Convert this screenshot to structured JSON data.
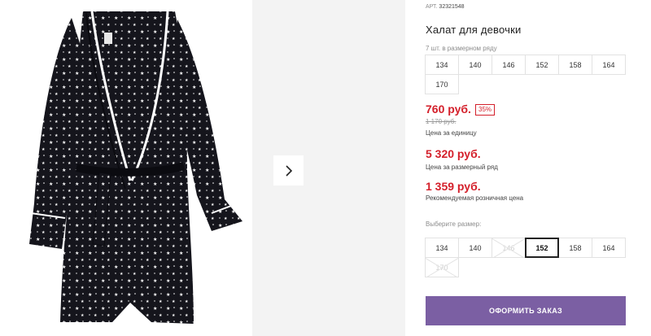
{
  "product": {
    "sku_label": "АРТ.",
    "sku_value": "32321548",
    "title": "Халат для девочки",
    "pack_note": "7 шт. в размерном ряду"
  },
  "pack_sizes": [
    "134",
    "140",
    "146",
    "152",
    "158",
    "164",
    "170"
  ],
  "prices": {
    "current": "760 руб.",
    "discount": "35%",
    "old": "1 170 руб.",
    "unit_label": "Цена за единицу",
    "pack": "5 320 руб.",
    "pack_label": "Цена за размерный ряд",
    "rrp": "1 359 руб.",
    "rrp_label": "Рекомендуемая розничная цена"
  },
  "size_selector": {
    "label": "Выберите размер:",
    "options": [
      {
        "label": "134",
        "state": "available"
      },
      {
        "label": "140",
        "state": "available"
      },
      {
        "label": "146",
        "state": "disabled"
      },
      {
        "label": "152",
        "state": "selected"
      },
      {
        "label": "158",
        "state": "available"
      },
      {
        "label": "164",
        "state": "available"
      },
      {
        "label": "170",
        "state": "disabled"
      }
    ]
  },
  "actions": {
    "order_label": "ОФОРМИТЬ ЗАКАЗ"
  },
  "colors": {
    "price_red": "#d4202b",
    "order_button": "#7b5fa3",
    "robe_fabric": "#15151c",
    "piping": "#ffffff"
  },
  "icons": {
    "gallery_next": "chevron-right-icon"
  }
}
